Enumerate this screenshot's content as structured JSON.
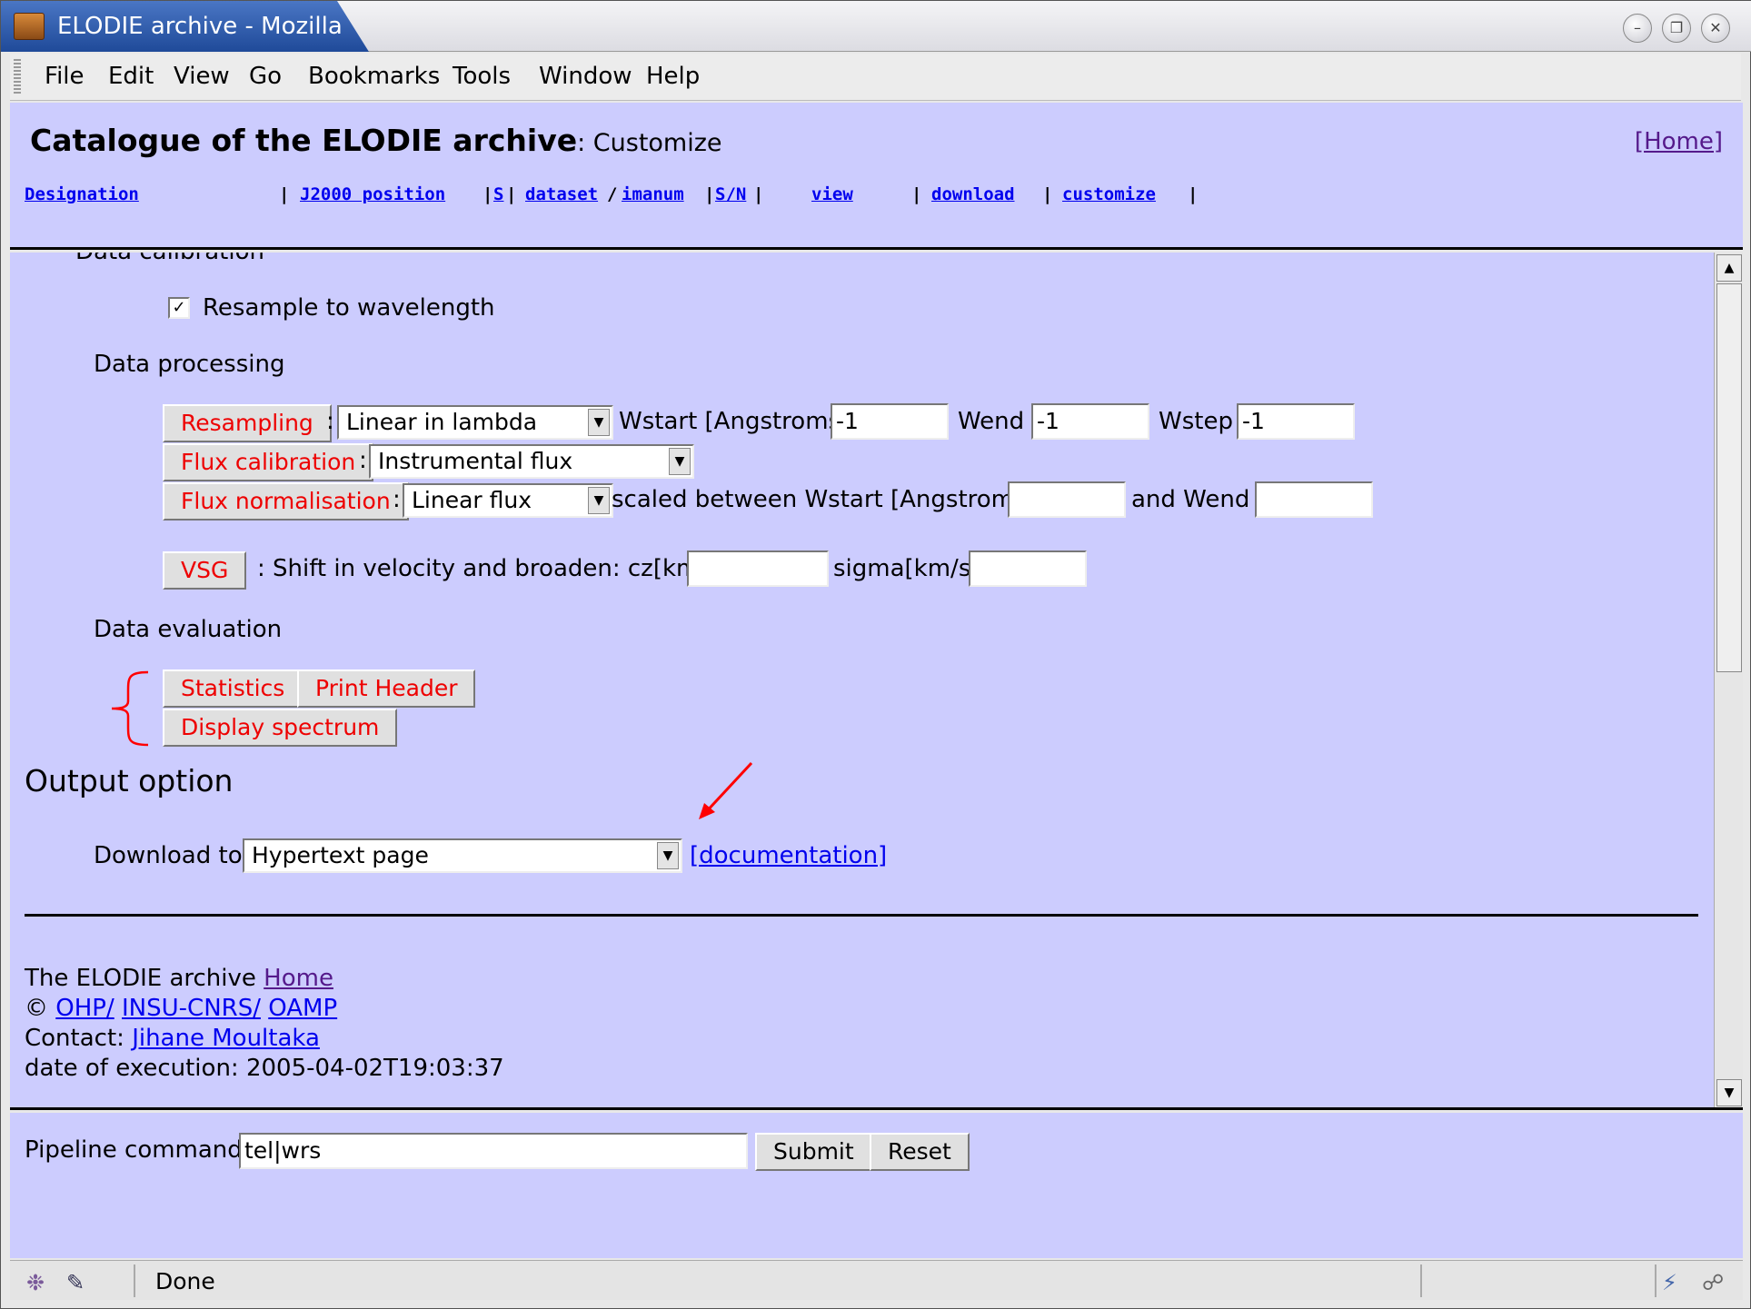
{
  "window": {
    "title": "ELODIE archive - Mozilla",
    "buttons": [
      "minimize-icon",
      "restore-icon",
      "close-icon"
    ]
  },
  "menu": [
    "File",
    "Edit",
    "View",
    "Go",
    "Bookmarks",
    "Tools",
    "Window",
    "Help"
  ],
  "header": {
    "title": "Catalogue of the ELODIE archive",
    "subtitle": ": Customize",
    "home": "[Home]",
    "nav": {
      "designation": "Designation",
      "position": "J2000 position",
      "s": "S",
      "dataset": "dataset",
      "imanum": "imanum",
      "sn": "S/N",
      "view": "view",
      "download": "download",
      "customize": "customize"
    }
  },
  "main": {
    "partial_heading": "Data calibration",
    "resample_label": "Resample to wavelength",
    "resample_checked": true,
    "processing_heading": "Data processing",
    "resampling_btn": "Resampling",
    "resampling_select": "Linear in lambda",
    "wstart_label": "Wstart [Angstroms]:",
    "wstart_value": "-1",
    "wend_label": "Wend :",
    "wend_value": "-1",
    "wstep_label": "Wstep :",
    "wstep_value": "-1",
    "fluxcal_btn": "Flux calibration",
    "fluxcal_select": "Instrumental flux",
    "fluxnorm_btn": "Flux normalisation",
    "fluxnorm_select": "Linear flux",
    "scaled_label": "scaled between Wstart [Angstroms]:",
    "and_wend_label": "and Wend :",
    "vsg_btn": "VSG",
    "vsg_label": ": Shift in velocity and broaden: cz[km/s]",
    "sigma_label": "sigma[km/s]",
    "evaluation_heading": "Data evaluation",
    "statistics_btn": "Statistics",
    "printheader_btn": "Print Header",
    "display_btn": "Display spectrum",
    "output_heading": "Output option",
    "download_label": "Download to:",
    "download_select": "Hypertext page",
    "documentation_link": "[documentation]",
    "footer_line1": "The ELODIE archive",
    "footer_home": "Home",
    "footer_copy": "©",
    "footer_ohp": "OHP/",
    "footer_insu": "INSU-CNRS/",
    "footer_oamp": "OAMP",
    "footer_contact": "Contact:",
    "footer_contact_name": "Jihane Moultaka",
    "footer_date": "date of execution: 2005-04-02T19:03:37"
  },
  "bottom": {
    "pipeline_label": "Pipeline command:",
    "pipeline_value": "tel|wrs",
    "submit": "Submit",
    "reset": "Reset"
  },
  "status": {
    "text": "Done"
  },
  "colors": {
    "page_bg": "#ccccfe",
    "button_text": "#ee0000",
    "link": "#0000ee",
    "visited_link": "#551a8b",
    "annotation": "#ff0000"
  }
}
